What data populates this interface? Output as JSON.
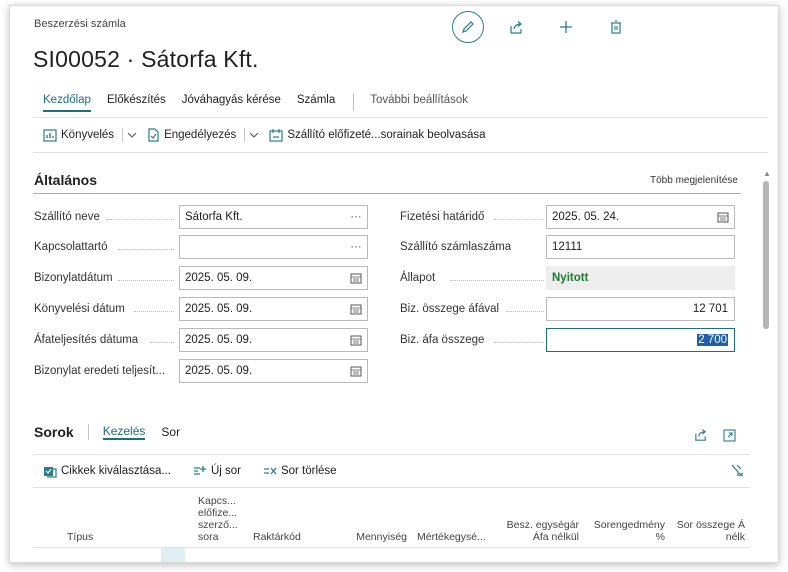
{
  "header": {
    "breadcrumb": "Beszerzési számla",
    "title": "SI00052 · Sátorfa Kft.",
    "actions": [
      "edit-icon",
      "share-icon",
      "plus-icon",
      "delete-icon"
    ]
  },
  "menu": {
    "items": [
      "Kezdőlap",
      "Előkészítés",
      "Jóváhagyás kérése",
      "Számla"
    ],
    "more": "További beállítások",
    "active": "Kezdőlap"
  },
  "actionbar": {
    "post": "Könyvelés",
    "approve": "Engedélyezés",
    "read_lines": "Szállító előfizeté...sorainak beolvasása"
  },
  "general": {
    "title": "Általános",
    "show_more": "Több megjelenítése",
    "left": [
      {
        "label": "Szállító neve",
        "value": "Sátorfa Kft.",
        "icon": "ellipsis"
      },
      {
        "label": "Kapcsolattartó",
        "value": "",
        "icon": "ellipsis"
      },
      {
        "label": "Bizonylatdátum",
        "value": "2025. 05. 09.",
        "icon": "calendar"
      },
      {
        "label": "Könyvelési dátum",
        "value": "2025. 05. 09.",
        "icon": "calendar"
      },
      {
        "label": "Áfateljesítés dátuma",
        "value": "2025. 05. 09.",
        "icon": "calendar"
      },
      {
        "label": "Bizonylat eredeti teljesít...",
        "value": "2025. 05. 09.",
        "icon": "calendar"
      }
    ],
    "right": [
      {
        "label": "Fizetési határidő",
        "value": "2025. 05. 24.",
        "icon": "calendar"
      },
      {
        "label": "Szállító számlaszáma",
        "value": "12111"
      },
      {
        "label": "Állapot",
        "value": "Nyitott"
      },
      {
        "label": "Biz. összege áfával",
        "value": "12 701"
      },
      {
        "label": "Biz. áfa összege",
        "value": "2 700"
      }
    ]
  },
  "lines": {
    "title": "Sorok",
    "tabs": [
      "Kezelés",
      "Sor"
    ],
    "actions": {
      "select_items": "Cikkek kiválasztása...",
      "new_line": "Új sor",
      "delete_line": "Sor törlése"
    },
    "columns": [
      "Típus",
      "Kapcs... előfize... szerző... sora",
      "Raktárkód",
      "Mennyiség",
      "Mértékegysé...",
      "Besz. egységár Áfa nélkül",
      "Sorengedmény %",
      "Sor összege Á nélk"
    ]
  }
}
